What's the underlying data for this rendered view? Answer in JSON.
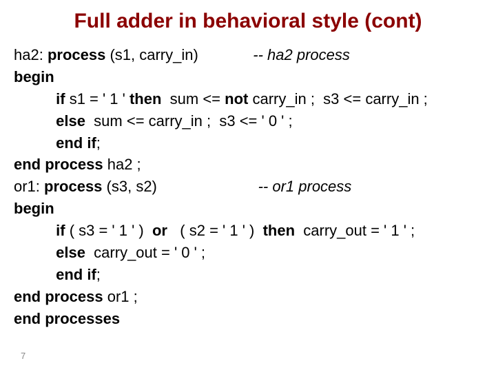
{
  "title": "Full adder in behavioral style (cont)",
  "lines": {
    "l1a": "ha2: ",
    "l1b": "process",
    "l1c": " (s1, carry_in)             ",
    "l1d": "-- ha2 process",
    "l2": "begin",
    "l3a": "          ",
    "l3b": "if",
    "l3c": " s1 = ' 1 ' ",
    "l3d": "then",
    "l3e": "  sum <= ",
    "l3f": "not",
    "l3g": " carry_in ;  s3 <= carry_in ;",
    "l4a": "          ",
    "l4b": "else",
    "l4c": "  sum <= carry_in ;  s3 <= ' 0 ' ;",
    "l5a": "          ",
    "l5b": "end if",
    "l5c": ";",
    "l6a": "end process",
    "l6b": " ha2 ;",
    "l7a": "or1: ",
    "l7b": "process",
    "l7c": " (s3, s2)                        ",
    "l7d": "-- or1 process",
    "l8": "begin",
    "l9a": "          ",
    "l9b": "if",
    "l9c": " ( s3 = ' 1 ' )  ",
    "l9d": "or",
    "l9e": "   ( s2 = ' 1 ' )  ",
    "l9f": "then",
    "l9g": "  carry_out = ' 1 ' ;",
    "l10a": "          ",
    "l10b": "else",
    "l10c": "  carry_out = ' 0 ' ;",
    "l11a": "          ",
    "l11b": "end if",
    "l11c": ";",
    "l12a": "end process",
    "l12b": " or1 ;",
    "l13": "end processes"
  },
  "pagenum": "7"
}
